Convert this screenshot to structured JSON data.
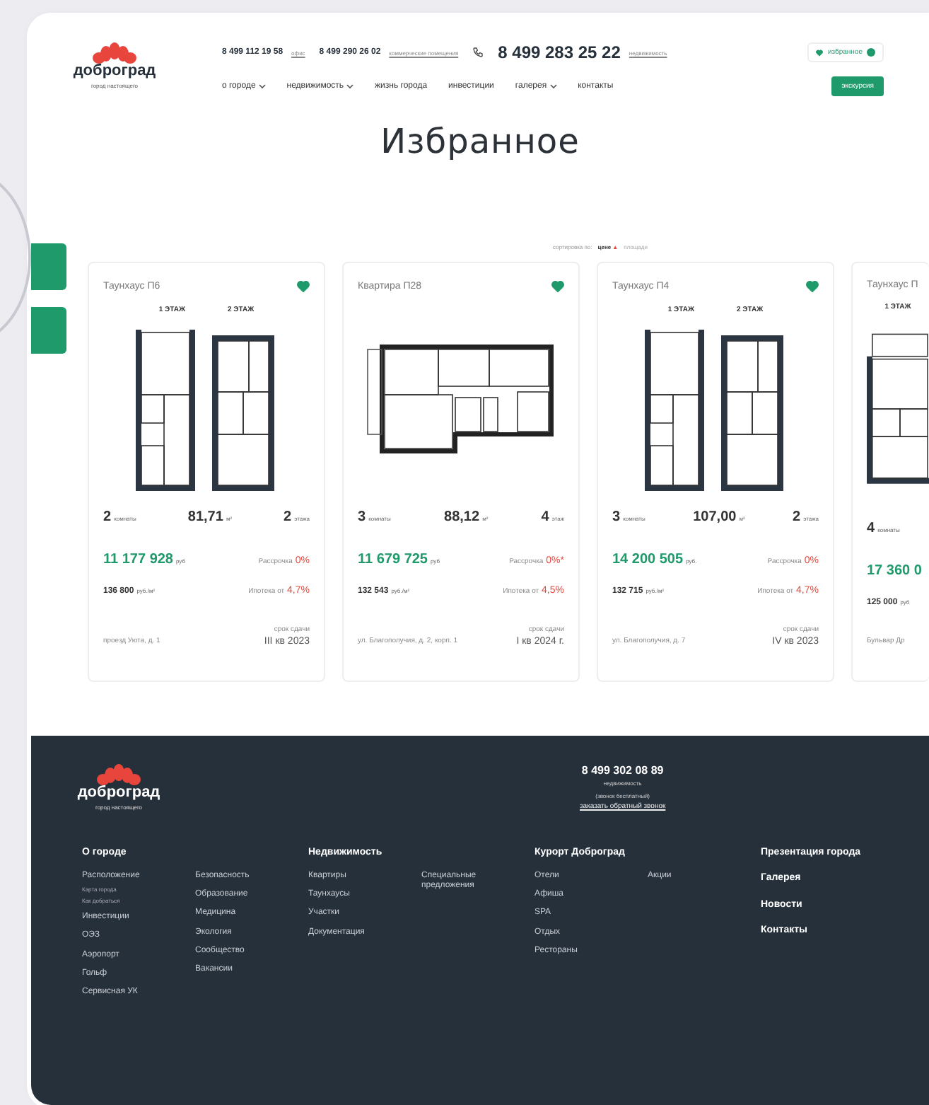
{
  "header": {
    "logo": {
      "name": "доброград",
      "tagline": "город настоящего"
    },
    "phones": [
      {
        "number": "8 499 112 19 58",
        "note": "офис"
      },
      {
        "number": "8 499 290 26 02",
        "note": "коммерческие помещения"
      }
    ],
    "main_phone": {
      "number": "8 499 283 25 22",
      "note": "недвижимость"
    },
    "favorites": {
      "label": "избранное",
      "active": true
    },
    "nav": [
      {
        "label": "о городе",
        "dropdown": true
      },
      {
        "label": "недвижимость",
        "dropdown": true
      },
      {
        "label": "жизнь города",
        "dropdown": false
      },
      {
        "label": "инвестиции",
        "dropdown": false
      },
      {
        "label": "галерея",
        "dropdown": true
      },
      {
        "label": "контакты",
        "dropdown": false
      }
    ],
    "cta": {
      "label": "экскурсия"
    }
  },
  "title": "Избранное",
  "sort": {
    "label": "сортировка по:",
    "options": [
      {
        "label": "цене",
        "direction": "▲",
        "selected": true
      },
      {
        "label": "площади",
        "selected": false
      }
    ]
  },
  "cards": [
    {
      "kind": "townhouse",
      "title": "Таунхаус П6",
      "favorite": true,
      "floor_labels": [
        "1 ЭТАЖ",
        "2 ЭТАЖ"
      ],
      "rooms": "2",
      "rooms_unit": "комнаты",
      "area": "81,71",
      "area_unit": "м²",
      "floors": "2",
      "floors_unit": "этажа",
      "price": "11 177 928",
      "price_unit": "руб",
      "per_m": "136 800",
      "per_m_unit": "руб./м²",
      "installment_label": "Рассрочка",
      "installment": "0%",
      "mortgage_label": "Ипотека от",
      "mortgage": "4,7%",
      "address": "проезд Уюта, д. 1",
      "deadline_label": "срок сдачи",
      "deadline": "III кв 2023"
    },
    {
      "kind": "apartment",
      "title": "Квартира П28",
      "favorite": true,
      "rooms": "3",
      "rooms_unit": "комнаты",
      "area": "88,12",
      "area_unit": "м²",
      "floors": "4",
      "floors_unit": "этаж",
      "price": "11 679 725",
      "price_unit": "руб",
      "per_m": "132 543",
      "per_m_unit": "руб./м²",
      "installment_label": "Рассрочка",
      "installment": "0%*",
      "mortgage_label": "Ипотека от",
      "mortgage": "4,5%",
      "address": "ул. Благополучия, д. 2, корп. 1",
      "deadline_label": "срок сдачи",
      "deadline": "I кв 2024 г."
    },
    {
      "kind": "townhouse",
      "title": "Таунхаус П4",
      "favorite": true,
      "floor_labels": [
        "1 ЭТАЖ",
        "2 ЭТАЖ"
      ],
      "rooms": "3",
      "rooms_unit": "комнаты",
      "area": "107,00",
      "area_unit": "м²",
      "floors": "2",
      "floors_unit": "этажа",
      "price": "14 200 505",
      "price_unit": "руб.",
      "per_m": "132 715",
      "per_m_unit": "руб./м²",
      "installment_label": "Рассрочка",
      "installment": "0%",
      "mortgage_label": "Ипотека от",
      "mortgage": "4,7%",
      "address": "ул. Благополучия, д. 7",
      "deadline_label": "срок сдачи",
      "deadline": "IV кв 2023"
    },
    {
      "kind": "partial",
      "title": "Таунхаус П",
      "floor_labels": [
        "1 ЭТАЖ"
      ],
      "rooms": "4",
      "rooms_unit": "комнаты",
      "price": "17 360 0",
      "per_m": "125 000",
      "per_m_unit": "руб",
      "address": "Бульвар Др"
    }
  ],
  "footer": {
    "logo": {
      "name": "доброград",
      "tagline": "город настоящего"
    },
    "phone": "8 499 302 08 89",
    "phone_note": "недвижимость",
    "phone_free": "(звонок бесплатный)",
    "callback": "заказать обратный звонок",
    "sections": [
      {
        "title": "О городе",
        "columns": [
          [
            {
              "label": "Расположение",
              "children": [
                {
                  "label": "Карта города"
                },
                {
                  "label": "Как добраться"
                }
              ]
            },
            {
              "label": "Инвестиции"
            },
            {
              "label": "ОЭЗ"
            },
            {
              "label": "Аэропорт"
            },
            {
              "label": "Гольф"
            },
            {
              "label": "Сервисная УК"
            }
          ],
          [
            {
              "label": "Безопасность"
            },
            {
              "label": "Образование"
            },
            {
              "label": "Медицина"
            },
            {
              "label": "Экология"
            },
            {
              "label": "Сообщество"
            },
            {
              "label": "Вакансии"
            }
          ]
        ]
      },
      {
        "title": "Недвижимость",
        "columns": [
          [
            {
              "label": "Квартиры"
            },
            {
              "label": "Таунхаусы"
            },
            {
              "label": "Участки"
            },
            {
              "label": "Документация"
            }
          ],
          [
            {
              "label": "Специальные предложения"
            }
          ]
        ]
      },
      {
        "title": "Курорт Доброград",
        "columns": [
          [
            {
              "label": "Отели"
            },
            {
              "label": "Афиша"
            },
            {
              "label": "SPA"
            },
            {
              "label": "Отдых"
            },
            {
              "label": "Рестораны"
            }
          ],
          [
            {
              "label": "Акции"
            }
          ]
        ]
      }
    ],
    "links": [
      "Презентация города",
      "Галерея",
      "Новости",
      "Контакты"
    ]
  }
}
